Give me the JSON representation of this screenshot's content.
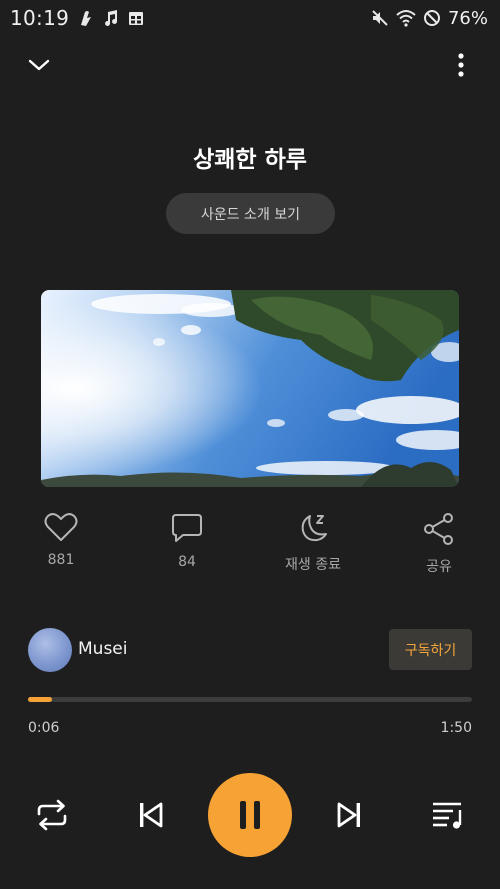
{
  "status_bar": {
    "time": "10:19",
    "battery": "76%",
    "icons": [
      "notification-icon",
      "music-note-icon",
      "calendar-icon",
      "mute-icon",
      "wifi-icon",
      "dnd-icon"
    ]
  },
  "top_bar": {
    "collapse_icon": "chevron-down-icon",
    "more_icon": "more-vertical-icon"
  },
  "track": {
    "title": "상쾌한 하루",
    "intro_label": "사운드 소개 보기"
  },
  "actions": {
    "like": {
      "icon": "heart-icon",
      "label": "881"
    },
    "comment": {
      "icon": "comment-icon",
      "label": "84"
    },
    "sleep_timer": {
      "icon": "moon-icon",
      "label": "재생 종료"
    },
    "share": {
      "icon": "share-icon",
      "label": "공유"
    }
  },
  "artist": {
    "name": "Musei",
    "subscribe_label": "구독하기"
  },
  "playback": {
    "current_time": "0:06",
    "total_time": "1:50",
    "progress": 0.055
  },
  "controls": {
    "repeat_icon": "repeat-icon",
    "previous_icon": "skip-previous-icon",
    "play_pause_icon": "pause-icon",
    "next_icon": "skip-next-icon",
    "playlist_icon": "playlist-icon"
  },
  "colors": {
    "accent": "#f7a234",
    "background": "#1e1e1e",
    "secondary_text": "#a7a7a7"
  }
}
